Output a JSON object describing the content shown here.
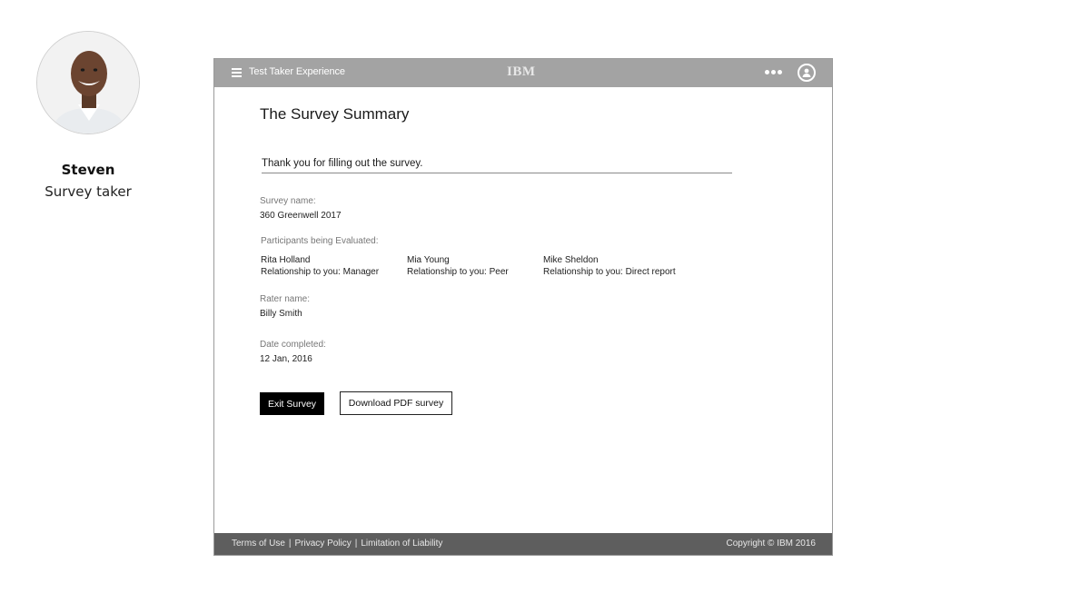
{
  "persona": {
    "name": "Steven",
    "role": "Survey taker"
  },
  "header": {
    "app_title": "Test Taker Experience",
    "logo_text": "IBM",
    "more_icon": "more-horizontal-icon",
    "user_icon": "user-avatar-icon"
  },
  "summary": {
    "title": "The Survey Summary",
    "thank_you": "Thank you for filling out the survey.",
    "survey_name_label": "Survey name:",
    "survey_name": "360 Greenwell 2017",
    "participants_label": "Participants being Evaluated:",
    "participants": [
      {
        "name": "Rita Holland",
        "relationship": "Relationship to you: Manager"
      },
      {
        "name": "Mia Young",
        "relationship": "Relationship to you: Peer"
      },
      {
        "name": "Mike Sheldon",
        "relationship": "Relationship to you: Direct report"
      }
    ],
    "rater_label": "Rater name:",
    "rater_name": "Billy Smith",
    "date_label": "Date completed:",
    "date_completed": "12 Jan, 2016"
  },
  "actions": {
    "exit_label": "Exit Survey",
    "download_label": "Download PDF survey"
  },
  "footer": {
    "links": [
      "Terms of Use",
      "Privacy Policy",
      "Limitation of Liability"
    ],
    "separator": "|",
    "copyright": "Copyright © IBM 2016"
  },
  "colors": {
    "header_bg": "#a3a3a3",
    "footer_bg": "#5e5e5e",
    "primary_button": "#000000"
  }
}
